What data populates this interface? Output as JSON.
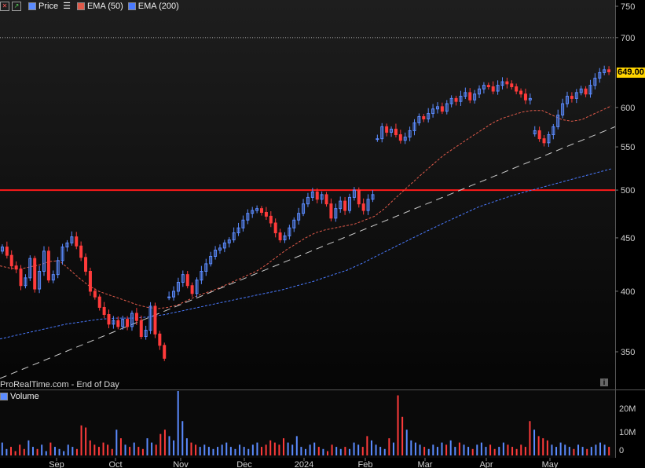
{
  "legend": {
    "price": "Price",
    "ema50": "EMA (50)",
    "ema200": "EMA (200)",
    "volume": "Volume"
  },
  "watermark": "ProRealTime.com - End of Day",
  "last_price": "649.00",
  "info_icon": "info-icon",
  "colors": {
    "up": "#5b8bff",
    "down": "#ff3b3b",
    "ema50": "#e05a4a",
    "ema200": "#4a7aff",
    "support": "#ff1a1a",
    "trend": "#cccccc",
    "tag": "#ffd400"
  },
  "chart_data": {
    "type": "candlestick",
    "y_ticks": [
      750,
      700,
      650,
      600,
      550,
      500,
      450,
      400,
      350
    ],
    "y_tick_labels": [
      "750",
      "700",
      "600",
      "550",
      "500",
      "450",
      "400",
      "350"
    ],
    "ylim": [
      320,
      760
    ],
    "volume_ticks": [
      "20M",
      "10M",
      "0"
    ],
    "x_labels": [
      "Sep",
      "Oct",
      "Nov",
      "Dec",
      "2024",
      "Feb",
      "Mar",
      "Apr",
      "May"
    ],
    "reference_levels": {
      "dotted": 700,
      "support": 500
    },
    "closes": [
      441,
      433,
      423,
      420,
      405,
      412,
      430,
      402,
      418,
      437,
      410,
      415,
      428,
      441,
      445,
      451,
      442,
      431,
      418,
      400,
      395,
      386,
      380,
      372,
      375,
      370,
      376,
      370,
      381,
      375,
      362,
      367,
      387,
      364,
      355,
      345,
      395,
      400,
      408,
      415,
      405,
      398,
      410,
      418,
      425,
      432,
      438,
      440,
      445,
      448,
      455,
      460,
      468,
      475,
      478,
      480,
      476,
      472,
      465,
      455,
      448,
      452,
      460,
      468,
      475,
      485,
      492,
      498,
      490,
      495,
      485,
      470,
      480,
      488,
      478,
      492,
      500,
      485,
      478,
      490,
      495,
      560,
      575,
      568,
      572,
      565,
      558,
      562,
      570,
      580,
      588,
      585,
      592,
      598,
      601,
      595,
      605,
      612,
      608,
      615,
      620,
      610,
      618,
      625,
      630,
      628,
      622,
      630,
      635,
      632,
      628,
      622,
      618,
      610,
      612,
      570,
      560,
      555,
      565,
      575,
      590,
      605,
      615,
      612,
      620,
      625,
      618,
      630,
      640,
      648,
      652,
      649
    ],
    "ema50": [
      423,
      421,
      420,
      422,
      424,
      427,
      428,
      420,
      412,
      405,
      400,
      397,
      394,
      391,
      388,
      386,
      385,
      386,
      388,
      392,
      396,
      399,
      402,
      406,
      410,
      414,
      418,
      424,
      431,
      438,
      444,
      450,
      455,
      458,
      460,
      462,
      464,
      468,
      472,
      480,
      490,
      500,
      510,
      520,
      530,
      540,
      548,
      556,
      564,
      572,
      580,
      586,
      590,
      594,
      596,
      596,
      590,
      584,
      582,
      584,
      590,
      596,
      602
    ],
    "ema200": [
      360,
      363,
      366,
      369,
      372,
      374,
      376,
      377,
      377,
      378,
      380,
      383,
      386,
      389,
      392,
      395,
      398,
      401,
      405,
      409,
      414,
      419,
      426,
      434,
      442,
      450,
      458,
      466,
      474,
      482,
      488,
      494,
      499,
      504,
      509,
      514,
      519,
      524
    ],
    "trend_line": {
      "from": 330,
      "to": 575
    },
    "volume": [
      6,
      3,
      4,
      2,
      5,
      3,
      7,
      4,
      3,
      5,
      2,
      6,
      4,
      3,
      2,
      5,
      4,
      3,
      14,
      13,
      7,
      5,
      4,
      6,
      5,
      3,
      12,
      8,
      5,
      4,
      6,
      4,
      3,
      8,
      6,
      5,
      10,
      12,
      9,
      7,
      30,
      16,
      8,
      6,
      5,
      4,
      5,
      4,
      3,
      4,
      5,
      6,
      4,
      3,
      5,
      4,
      3,
      5,
      6,
      4,
      5,
      7,
      6,
      5,
      8,
      6,
      5,
      9,
      4,
      3,
      5,
      6,
      4,
      3,
      2,
      5,
      4,
      3,
      4,
      3,
      6,
      5,
      4,
      9,
      7,
      5,
      4,
      3,
      8,
      6,
      28,
      18,
      12,
      7,
      6,
      5,
      4,
      3,
      5,
      4,
      6,
      5,
      7,
      4,
      6,
      5,
      4,
      3,
      5,
      6,
      4,
      5,
      3,
      4,
      6,
      5,
      4,
      3,
      5,
      4,
      16,
      12,
      9,
      8,
      7,
      5,
      4,
      6,
      5,
      4,
      3,
      5,
      4,
      3,
      4,
      5,
      6,
      5,
      4
    ]
  }
}
